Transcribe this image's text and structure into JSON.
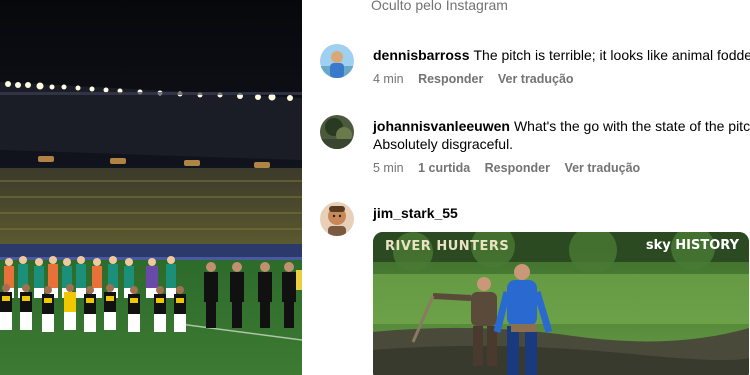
{
  "header": {
    "hidden_note": "Oculto pelo Instagram"
  },
  "comments": [
    {
      "username": "dennisbarross",
      "text": "The pitch is terrible; it looks like animal fodder",
      "time": "4 min",
      "likes": "",
      "reply_label": "Responder",
      "translate_label": "Ver tradução"
    },
    {
      "username": "johannisvanleeuwen",
      "text": "What's the go with the state of the pitch?",
      "text_line2": "Absolutely disgraceful.",
      "time": "5 min",
      "likes": "1 curtida",
      "reply_label": "Responder",
      "translate_label": "Ver tradução"
    },
    {
      "username": "jim_stark_55",
      "text": "",
      "gif": {
        "tag_left": "RIVER HUNTERS",
        "tag_right": "sky HISTORY"
      }
    }
  ],
  "colors": {
    "meta_gray": "#737373",
    "pitch_green": "#2f6e2f",
    "jersey_orange": "#e8713a",
    "jersey_teal": "#1b8f7a"
  }
}
